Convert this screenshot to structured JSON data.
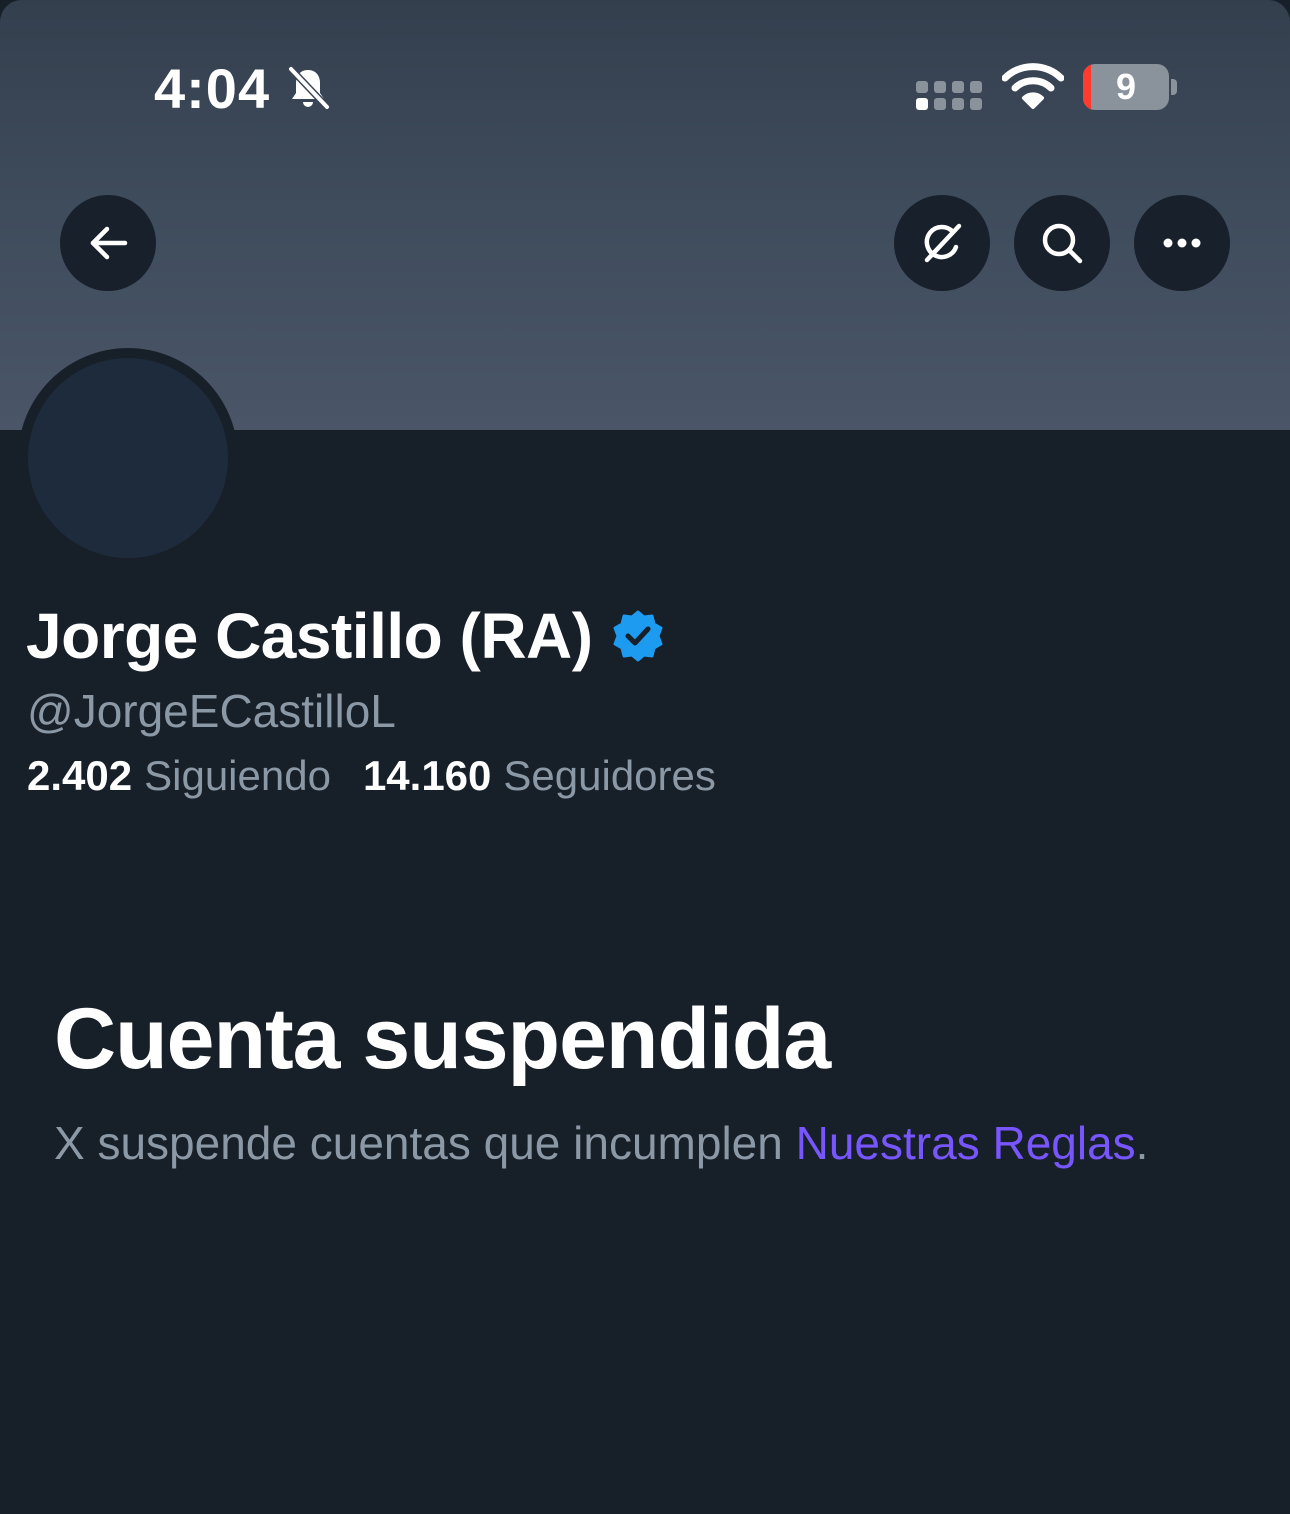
{
  "status_bar": {
    "time": "4:04",
    "battery_level": "9",
    "battery_fraction": 0.09,
    "bell_icon": "bell-slash-icon",
    "signal_icon": "cellular-signal-icon",
    "wifi_icon": "wifi-icon"
  },
  "toolbar": {
    "back_icon": "arrow-left-icon",
    "grok_icon": "grok-icon",
    "search_icon": "search-icon",
    "more_icon": "more-horizontal-icon"
  },
  "profile": {
    "display_name": "Jorge Castillo (RA)",
    "verified_icon": "verified-badge-icon",
    "handle": "@JorgeECastilloL",
    "following_count": "2.402",
    "following_label": "Siguiendo",
    "followers_count": "14.160",
    "followers_label": "Seguidores"
  },
  "suspension": {
    "title": "Cuenta suspendida",
    "description": "X suspende cuentas que incumplen ",
    "rules_link": "Nuestras Reglas",
    "period": "."
  },
  "colors": {
    "background": "#171f29",
    "banner": "#3e4b5b",
    "muted_text": "#8b98a5",
    "link": "#7856ff",
    "verified": "#1d9bf0",
    "battery_low": "#ff3b30"
  }
}
